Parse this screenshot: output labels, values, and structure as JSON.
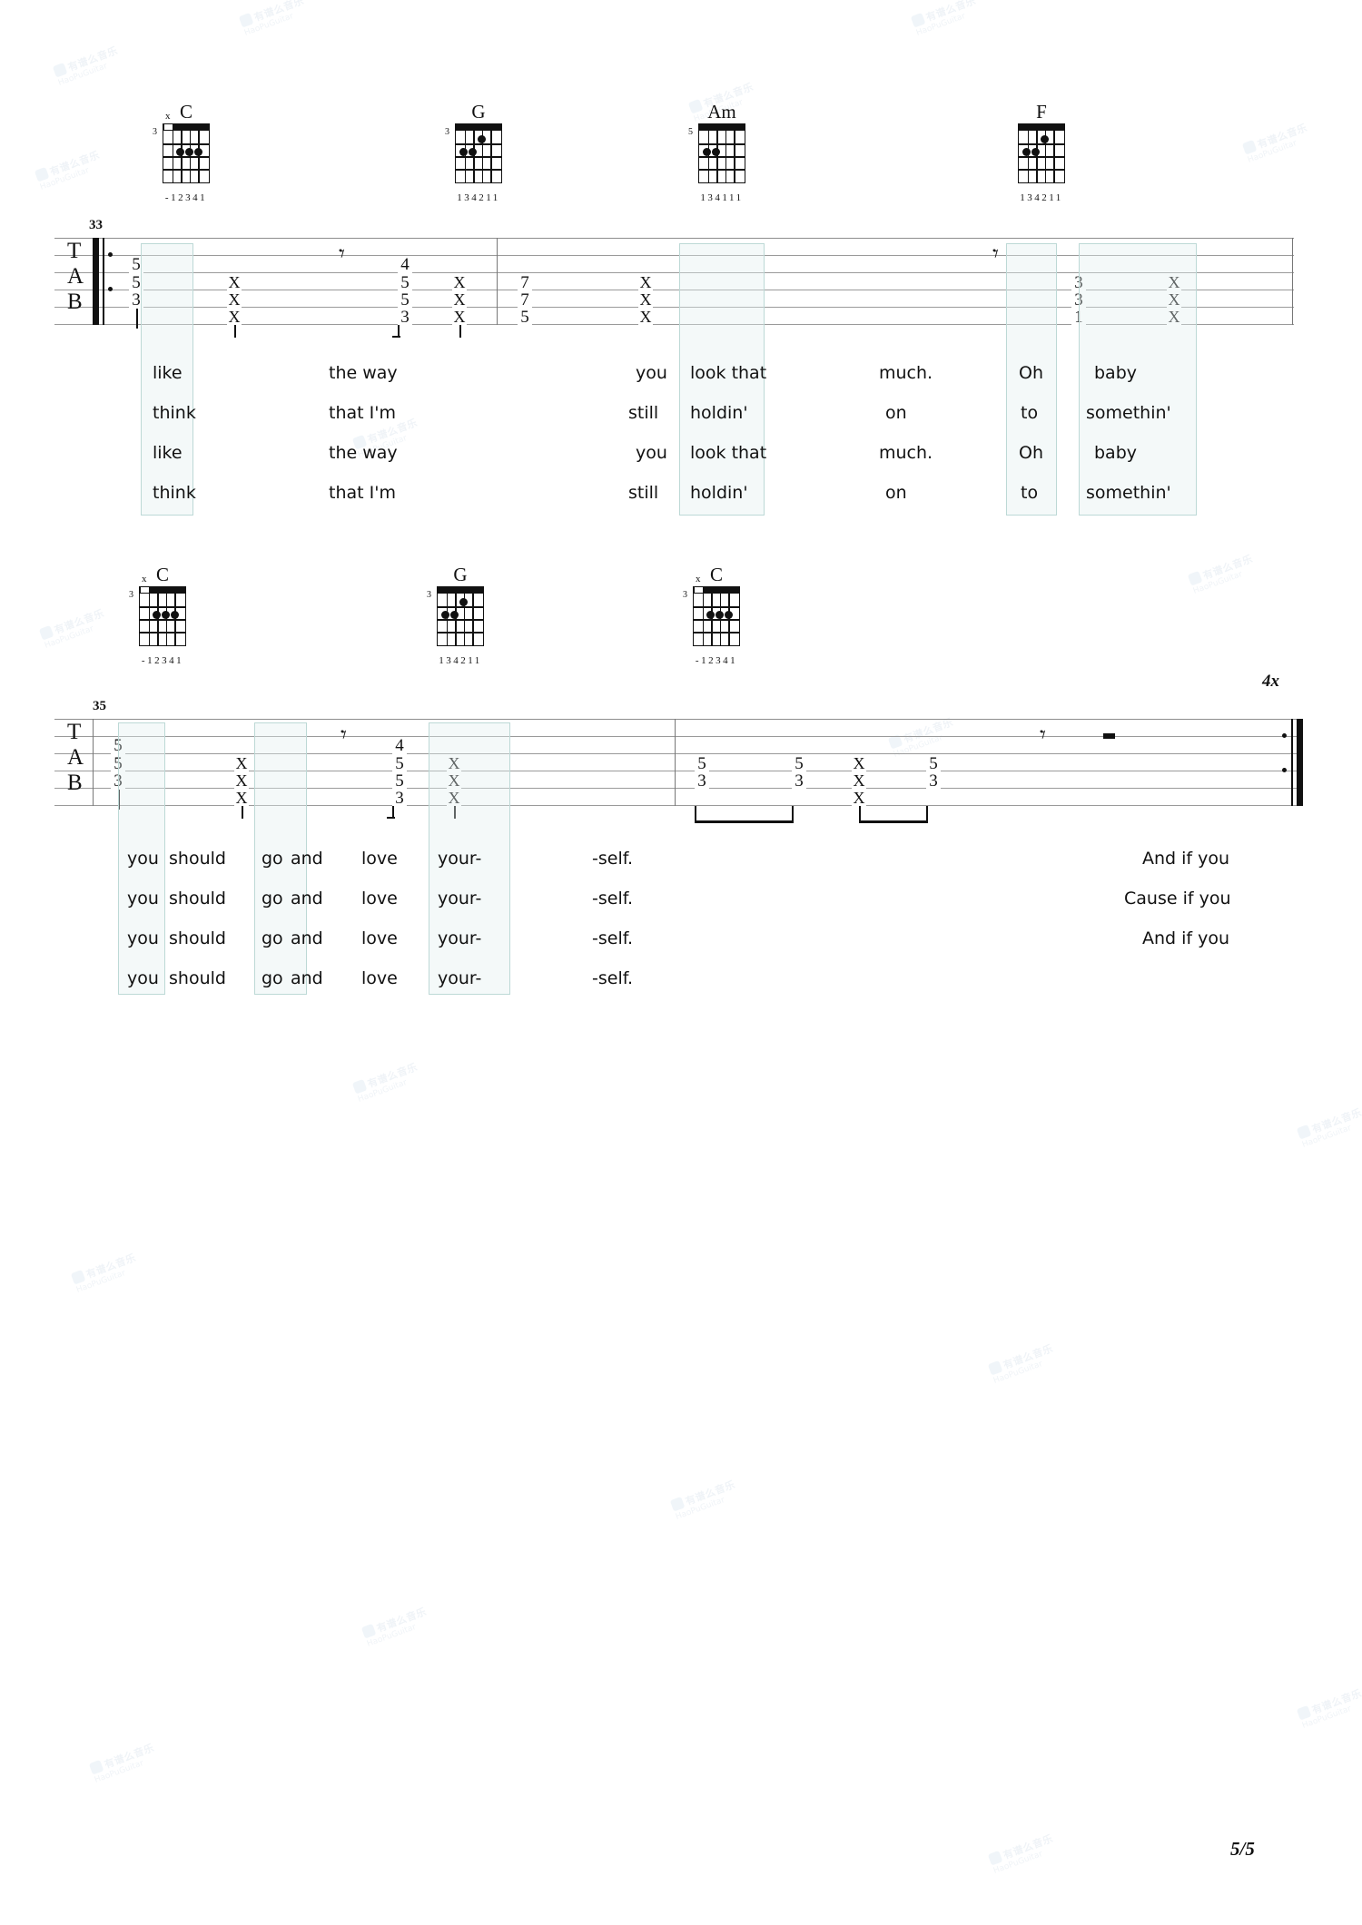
{
  "page": {
    "number_label": "5/5",
    "repeat_label": "4x"
  },
  "watermark": {
    "line1": "有谱么音乐",
    "line2": "HaoPuGuitar"
  },
  "systems": [
    {
      "id": "system-1",
      "measure_start": "33",
      "chords": [
        {
          "name": "C",
          "base_fret": "3",
          "muted_strings": "x",
          "fingers": "-12341",
          "dots": [
            [
              2,
              2
            ],
            [
              3,
              2
            ],
            [
              4,
              2
            ]
          ]
        },
        {
          "name": "G",
          "base_fret": "3",
          "muted_strings": "",
          "fingers": "134211",
          "dots": [
            [
              1,
              2
            ],
            [
              2,
              2
            ],
            [
              3,
              1
            ]
          ]
        },
        {
          "name": "Am",
          "base_fret": "5",
          "muted_strings": "",
          "fingers": "134111",
          "dots": [
            [
              1,
              2
            ],
            [
              2,
              2
            ]
          ]
        },
        {
          "name": "F",
          "base_fret": "",
          "muted_strings": "",
          "fingers": "134211",
          "dots": [
            [
              1,
              2
            ],
            [
              2,
              2
            ],
            [
              3,
              1
            ]
          ]
        }
      ],
      "tab_events": [
        {
          "type": "chord",
          "frets": {
            "1": "5",
            "2": "5",
            "3": "3"
          }
        },
        {
          "type": "mute",
          "strings": [
            "2",
            "3",
            "4"
          ]
        },
        {
          "type": "rest"
        },
        {
          "type": "chord",
          "frets": {
            "1": "4",
            "2": "5",
            "3": "5",
            "4": "3"
          }
        },
        {
          "type": "mute",
          "strings": [
            "2",
            "3",
            "4"
          ]
        },
        {
          "type": "chord",
          "frets": {
            "2": "7",
            "3": "7",
            "4": "5"
          }
        },
        {
          "type": "mute",
          "strings": [
            "2",
            "3",
            "4"
          ]
        },
        {
          "type": "rest"
        },
        {
          "type": "chord",
          "frets": {
            "2": "3",
            "3": "3",
            "4": "1"
          }
        },
        {
          "type": "mute",
          "strings": [
            "2",
            "3",
            "4"
          ]
        }
      ],
      "lyrics": [
        [
          "like",
          "the way",
          "you",
          "look that",
          "much.",
          "Oh",
          "baby"
        ],
        [
          "think",
          "that I'm",
          "still",
          "holdin'",
          "on",
          "to",
          "somethin'"
        ],
        [
          "like",
          "the way",
          "you",
          "look that",
          "much.",
          "Oh",
          "baby"
        ],
        [
          "think",
          "that I'm",
          "still",
          "holdin'",
          "on",
          "to",
          "somethin'"
        ]
      ]
    },
    {
      "id": "system-2",
      "measure_start": "35",
      "chords": [
        {
          "name": "C",
          "base_fret": "3",
          "muted_strings": "x",
          "fingers": "-12341",
          "dots": [
            [
              2,
              2
            ],
            [
              3,
              2
            ],
            [
              4,
              2
            ]
          ]
        },
        {
          "name": "G",
          "base_fret": "3",
          "muted_strings": "",
          "fingers": "134211",
          "dots": [
            [
              1,
              2
            ],
            [
              2,
              2
            ],
            [
              3,
              1
            ]
          ]
        },
        {
          "name": "C",
          "base_fret": "3",
          "muted_strings": "x",
          "fingers": "-12341",
          "dots": [
            [
              2,
              2
            ],
            [
              3,
              2
            ],
            [
              4,
              2
            ]
          ]
        }
      ],
      "tab_events": [
        {
          "type": "chord",
          "frets": {
            "1": "5",
            "2": "5",
            "3": "3"
          }
        },
        {
          "type": "mute",
          "strings": [
            "2",
            "3",
            "4"
          ]
        },
        {
          "type": "rest"
        },
        {
          "type": "chord",
          "frets": {
            "1": "4",
            "2": "5",
            "3": "5",
            "4": "3"
          }
        },
        {
          "type": "mute",
          "strings": [
            "2",
            "3",
            "4"
          ]
        },
        {
          "type": "chord",
          "frets": {
            "2": "5",
            "3": "3"
          }
        },
        {
          "type": "chord",
          "frets": {
            "2": "5",
            "3": "3"
          }
        },
        {
          "type": "mute",
          "strings": [
            "2",
            "3",
            "4"
          ]
        },
        {
          "type": "chord",
          "frets": {
            "2": "5",
            "3": "3"
          }
        },
        {
          "type": "rest_bar"
        }
      ],
      "lyrics": [
        [
          "you",
          "should",
          "go",
          "and",
          "love",
          "your-",
          "-self.",
          "And if you"
        ],
        [
          "you",
          "should",
          "go",
          "and",
          "love",
          "your-",
          "-self.",
          "Cause if you"
        ],
        [
          "you",
          "should",
          "go",
          "and",
          "love",
          "your-",
          "-self.",
          "And if you"
        ],
        [
          "you",
          "should",
          "go",
          "and",
          "love",
          "your-",
          "-self.",
          ""
        ]
      ]
    }
  ]
}
